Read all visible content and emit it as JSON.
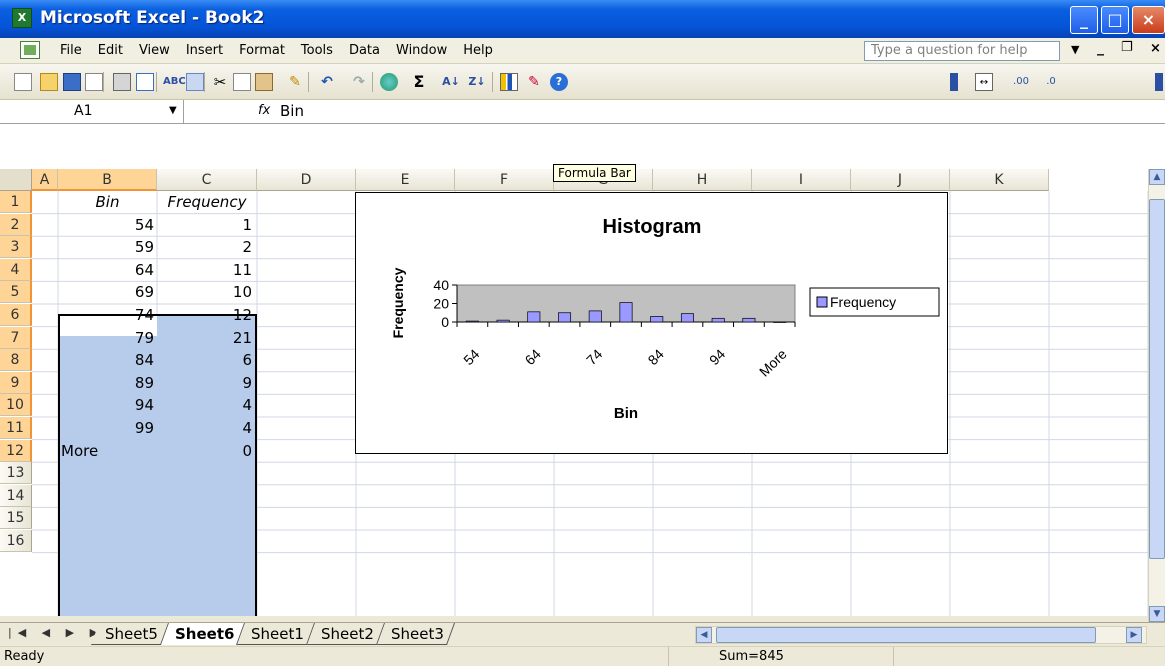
{
  "window": {
    "title": "Microsoft Excel - Book2",
    "app_icon": "excel-icon"
  },
  "menu": {
    "items": [
      "File",
      "Edit",
      "View",
      "Insert",
      "Format",
      "Tools",
      "Data",
      "Window",
      "Help"
    ],
    "help_placeholder": "Type a question for help"
  },
  "formula_bar": {
    "cell_ref": "A1",
    "fx": "fx",
    "value": "Bin"
  },
  "tooltip": "Formula Bar",
  "columns": [
    "A",
    "B",
    "C",
    "D",
    "E",
    "F",
    "G",
    "H",
    "I",
    "J",
    "K"
  ],
  "rows": [
    "1",
    "2",
    "3",
    "4",
    "5",
    "6",
    "7",
    "8",
    "9",
    "10",
    "11",
    "12",
    "13",
    "14",
    "15",
    "16"
  ],
  "table": {
    "headers": [
      "Bin",
      "Frequency"
    ],
    "bins": [
      "54",
      "59",
      "64",
      "69",
      "74",
      "79",
      "84",
      "89",
      "94",
      "99",
      "More"
    ],
    "frequencies": [
      "1",
      "2",
      "11",
      "10",
      "12",
      "21",
      "6",
      "9",
      "4",
      "4",
      "0"
    ]
  },
  "chart_data": {
    "type": "bar",
    "title": "Histogram",
    "xlabel": "Bin",
    "ylabel": "Frequency",
    "categories": [
      "54",
      "59",
      "64",
      "69",
      "74",
      "79",
      "84",
      "89",
      "94",
      "99",
      "More"
    ],
    "x_tick_labels": [
      "54",
      "64",
      "74",
      "84",
      "94",
      "More"
    ],
    "series": [
      {
        "name": "Frequency",
        "values": [
          1,
          2,
          11,
          10,
          12,
          21,
          6,
          9,
          4,
          4,
          0
        ]
      }
    ],
    "yticks": [
      "40",
      "20",
      "0"
    ],
    "ylim": [
      0,
      40
    ],
    "legend": "right",
    "colors": {
      "bar": "#9999ff",
      "plot_area": "#c0c0c0"
    }
  },
  "sheets": {
    "tabs": [
      "Sheet5",
      "Sheet6",
      "Sheet1",
      "Sheet2",
      "Sheet3"
    ],
    "active": "Sheet6"
  },
  "status": {
    "text": "Ready",
    "sum": "Sum=845"
  }
}
